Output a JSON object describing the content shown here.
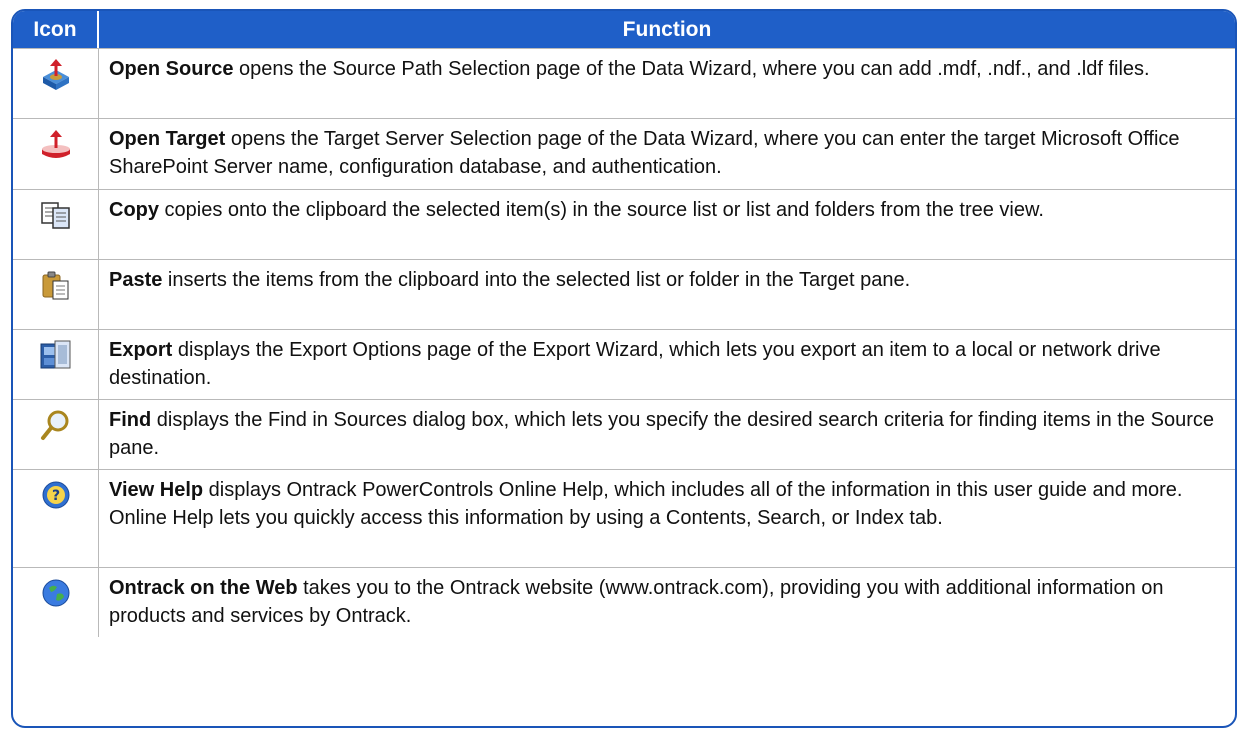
{
  "header": {
    "icon_col": "Icon",
    "function_col": "Function"
  },
  "rows": [
    {
      "icon": "open-source-icon",
      "name": "Open Source",
      "desc": " opens the Source Path Selection page of the Data Wizard, where you can add .mdf, .ndf., and .ldf files."
    },
    {
      "icon": "open-target-icon",
      "name": "Open Target",
      "desc": " opens the Target Server Selection page of the Data Wizard, where you can enter the target Microsoft Office SharePoint Server name, configuration database, and authentication."
    },
    {
      "icon": "copy-icon",
      "name": "Copy",
      "desc": " copies onto the clipboard the selected item(s) in the source list or list and folders from the tree view."
    },
    {
      "icon": "paste-icon",
      "name": "Paste",
      "desc": " inserts the items from the clipboard into the selected list or folder in the Target pane."
    },
    {
      "icon": "export-icon",
      "name": "Export",
      "desc": " displays the Export Options page of the Export Wizard, which lets you export an item to a local or network drive destination."
    },
    {
      "icon": "find-icon",
      "name": "Find",
      "desc": " displays the Find in Sources dialog box, which lets you specify the desired search criteria for finding items in the Source pane."
    },
    {
      "icon": "help-icon",
      "name": "View Help",
      "desc": " displays Ontrack PowerControls Online Help, which includes all of the information in this user guide and more. Online Help lets you quickly access this information by using a Contents, Search, or Index tab."
    },
    {
      "icon": "web-icon",
      "name": "Ontrack on the Web",
      "desc": " takes you to the Ontrack website (www.ontrack.com), providing you with additional information on products and services by Ontrack."
    }
  ]
}
